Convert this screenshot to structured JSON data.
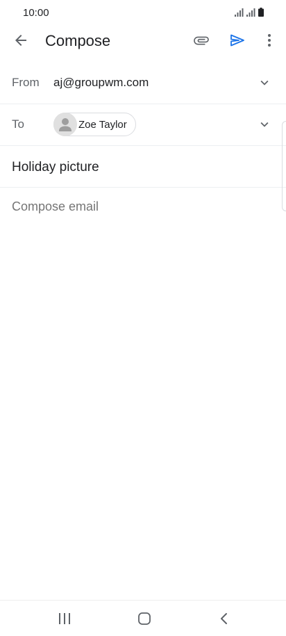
{
  "status_bar": {
    "time": "10:00",
    "icons": [
      "signal-icon",
      "signal-icon",
      "battery-icon"
    ]
  },
  "toolbar": {
    "title": "Compose",
    "back_icon": "arrow-back-icon",
    "attach_icon": "paperclip-icon",
    "send_icon": "send-icon",
    "more_icon": "more-vert-icon"
  },
  "compose": {
    "from_label": "From",
    "from_value": "aj@groupwm.com",
    "to_label": "To",
    "recipients": [
      {
        "name": "Zoe Taylor"
      }
    ],
    "subject": "Holiday picture",
    "body_placeholder": "Compose email"
  },
  "colors": {
    "accent": "#1a73e8",
    "text_primary": "#202124",
    "text_secondary": "#5f6368",
    "divider": "#eceff1"
  },
  "nav_bar": {
    "icons": [
      "recents-icon",
      "home-icon",
      "back-icon"
    ]
  }
}
